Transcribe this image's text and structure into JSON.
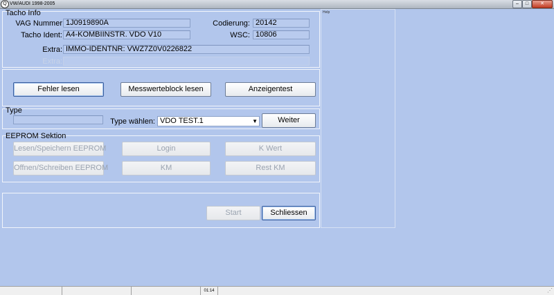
{
  "window": {
    "title": "VW/AUDI 1998-2005",
    "icon": "magnifier-app-icon",
    "min_glyph": "–",
    "max_glyph": "□",
    "close_glyph": "✕"
  },
  "tacho_info": {
    "title": "Tacho Info",
    "vag_nummer_label": "VAG Nummer",
    "vag_nummer_value": "1J0919890A",
    "codierung_label": "Codierung:",
    "codierung_value": "20142",
    "tacho_ident_label": "Tacho Ident:",
    "tacho_ident_value": "A4-KOMBIINSTR. VDO V10",
    "wsc_label": "WSC:",
    "wsc_value": "10806",
    "extra_label": "Extra:",
    "extra_value": "IMMO-IDENTNR: VWZ7Z0V0226822",
    "extra2_label": "Extra:",
    "extra2_value": ""
  },
  "actions": {
    "fehler_lesen": "Fehler lesen",
    "messwerteblock_lesen": "Messwerteblock lesen",
    "anzeigentest": "Anzeigentest"
  },
  "type": {
    "title": "Type",
    "field_value": "",
    "select_label": "Type wählen:",
    "selected": "VDO  TEST.1",
    "weiter": "Weiter"
  },
  "eeprom": {
    "title": "EEPROM Sektion",
    "lesen_speichern": "Lesen/Speichern EEPROM",
    "login": "Login",
    "k_wert": "K Wert",
    "offnen_schreiben": "Offnen/Schreiben EEPROM",
    "km": "KM",
    "rest_km": "Rest KM"
  },
  "bottom": {
    "start": "Start",
    "schliessen": "Schliessen"
  },
  "help": {
    "label": "Help"
  },
  "status_bar": {
    "time": "01:14"
  }
}
